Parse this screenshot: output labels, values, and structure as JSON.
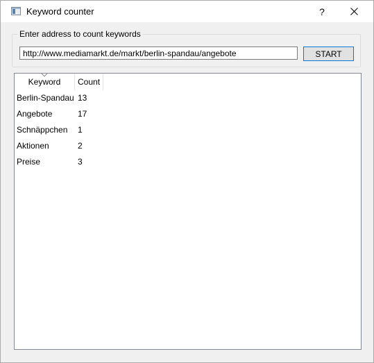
{
  "window": {
    "title": "Keyword counter",
    "help_label": "?"
  },
  "form": {
    "group_title": "Enter address to count keywords",
    "url_value": "http://www.mediamarkt.de/markt/berlin-spandau/angebote",
    "start_label": "START"
  },
  "table": {
    "headers": {
      "keyword": "Keyword",
      "count": "Count"
    },
    "sort_indicator": "sort-ascending",
    "rows": [
      {
        "keyword": "Berlin-Spandau",
        "count": "13"
      },
      {
        "keyword": "Angebote",
        "count": "17"
      },
      {
        "keyword": "Schnäppchen",
        "count": "1"
      },
      {
        "keyword": "Aktionen",
        "count": "2"
      },
      {
        "keyword": "Preise",
        "count": "3"
      }
    ]
  }
}
